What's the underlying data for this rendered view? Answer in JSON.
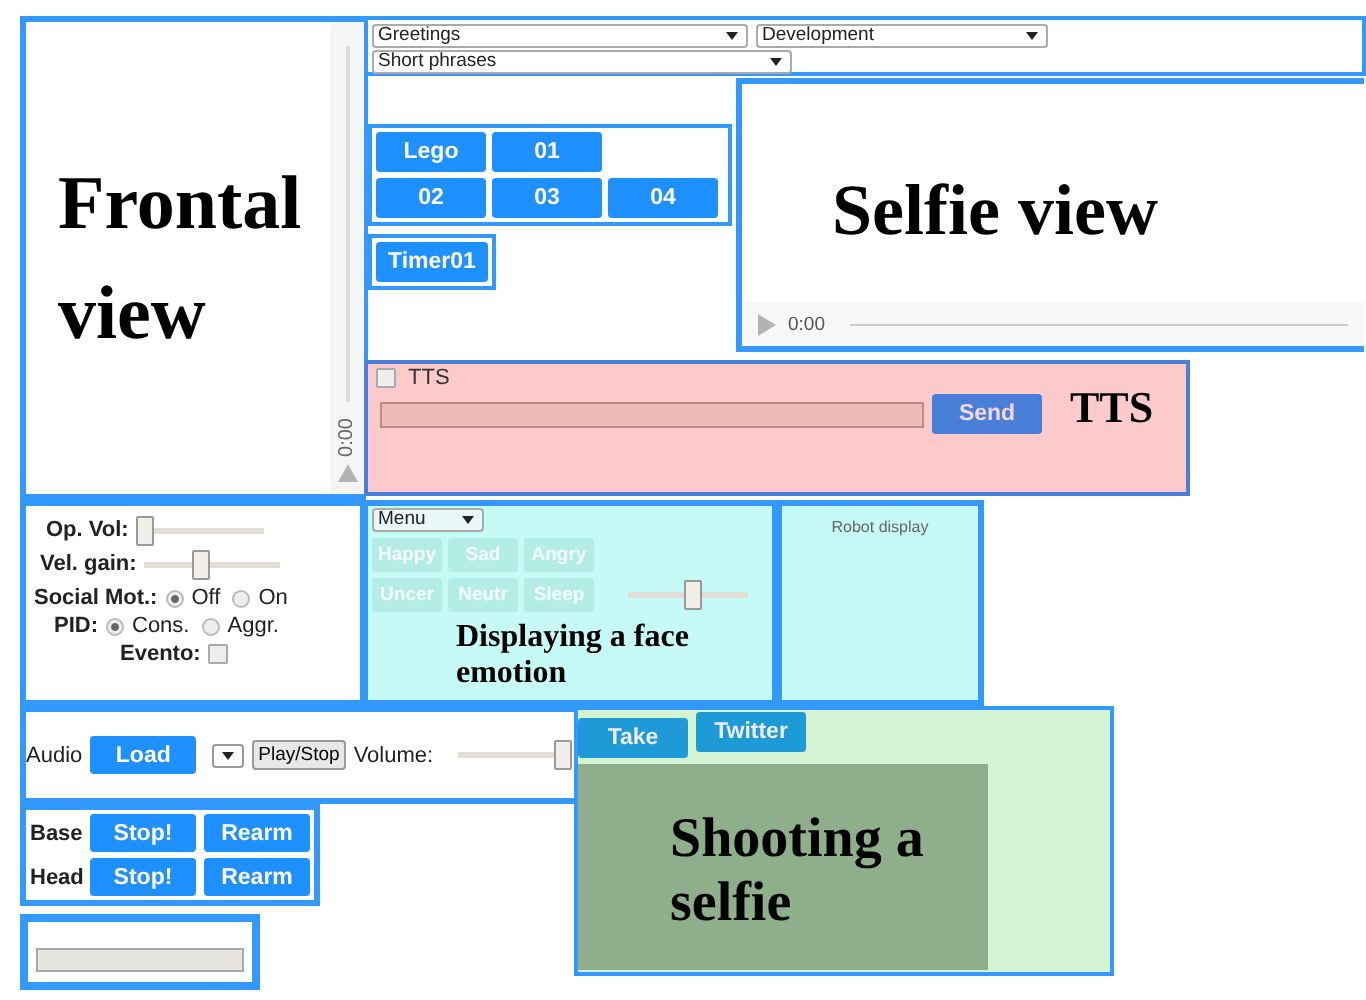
{
  "frontal_view": {
    "label": "Frontal view",
    "time": "0:00"
  },
  "dropdowns": [
    {
      "value": "Greetings"
    },
    {
      "value": "Development"
    },
    {
      "value": "Short phrases"
    }
  ],
  "quick_buttons": [
    {
      "buttons": [
        "Lego",
        "01"
      ]
    },
    {
      "buttons": [
        "02",
        "03",
        "04"
      ]
    }
  ],
  "timer_button": "Timer01",
  "selfie_view": {
    "label": "Selfie view",
    "time": "0:00"
  },
  "tts": {
    "checkbox_label": "TTS",
    "checked": false,
    "send_button": "Send",
    "label": "TTS"
  },
  "controls": {
    "sliders": [
      {
        "label": "Op. Vol:",
        "level": 0
      },
      {
        "label": "Vel. gain:",
        "level": 0.4
      }
    ],
    "radio_groups": [
      {
        "label": "Social Mot.:",
        "options": [
          {
            "label": "Off",
            "selected": true
          },
          {
            "label": "On",
            "selected": false
          }
        ]
      },
      {
        "label": "PID:",
        "options": [
          {
            "label": "Cons.",
            "selected": true
          },
          {
            "label": "Aggr.",
            "selected": false
          }
        ]
      }
    ],
    "checkbox": {
      "label": "Evento:",
      "checked": false
    }
  },
  "emotion": {
    "menu": "Menu",
    "rows": [
      {
        "buttons": [
          "Happy",
          "Sad",
          "Angry"
        ]
      },
      {
        "buttons": [
          "Uncer",
          "Neutr",
          "Sleep"
        ]
      }
    ],
    "level": 0.55,
    "label": "Displaying a face emotion"
  },
  "robot_display": {
    "title": "Robot display"
  },
  "audio": {
    "label": "Audio",
    "load_button": "Load",
    "play_button": "Play/Stop",
    "volume_label": "Volume:",
    "level": 1
  },
  "motors": [
    {
      "label": "Base",
      "stop": "Stop!",
      "rearm": "Rearm"
    },
    {
      "label": "Head",
      "stop": "Stop!",
      "rearm": "Rearm"
    }
  ],
  "selfie": {
    "buttons": [
      "Take",
      "Twitter"
    ],
    "label": "Shooting a selfie"
  }
}
